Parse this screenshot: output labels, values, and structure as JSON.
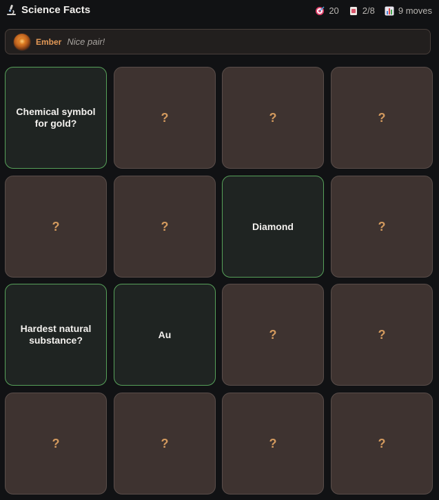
{
  "header": {
    "title": "Science Facts",
    "title_icon": "microscope-icon",
    "stats": [
      {
        "icon": "target-icon",
        "value": "20"
      },
      {
        "icon": "cards-icon",
        "value": "2/8"
      },
      {
        "icon": "bar-chart-icon",
        "value": "9 moves"
      }
    ]
  },
  "banner": {
    "speaker": "Ember",
    "message": "Nice pair!"
  },
  "colors": {
    "background": "#111214",
    "card_back": "#3e3330",
    "card_face": "#1f2422",
    "matched_border": "#58a35b",
    "question_mark": "#d39a5e",
    "speaker_name": "#e59a57"
  },
  "board": {
    "cards": [
      {
        "state": "revealed",
        "text": "Chemical symbol for gold?"
      },
      {
        "state": "hidden",
        "text": "?"
      },
      {
        "state": "hidden",
        "text": "?"
      },
      {
        "state": "hidden",
        "text": "?"
      },
      {
        "state": "hidden",
        "text": "?"
      },
      {
        "state": "hidden",
        "text": "?"
      },
      {
        "state": "revealed",
        "text": "Diamond"
      },
      {
        "state": "hidden",
        "text": "?"
      },
      {
        "state": "revealed",
        "text": "Hardest natural substance?"
      },
      {
        "state": "revealed",
        "text": "Au"
      },
      {
        "state": "hidden",
        "text": "?"
      },
      {
        "state": "hidden",
        "text": "?"
      },
      {
        "state": "hidden",
        "text": "?"
      },
      {
        "state": "hidden",
        "text": "?"
      },
      {
        "state": "hidden",
        "text": "?"
      },
      {
        "state": "hidden",
        "text": "?"
      }
    ]
  }
}
